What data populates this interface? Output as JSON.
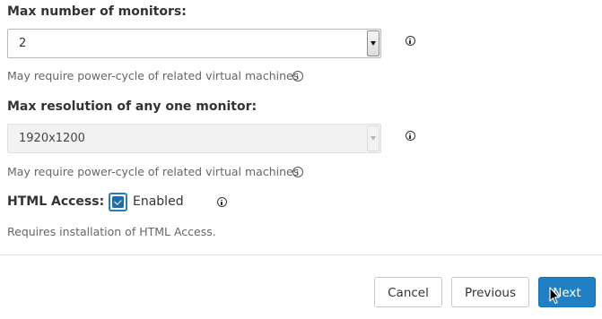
{
  "monitors": {
    "label": "Max number of monitors:",
    "value": "2",
    "hint": "May require power-cycle of related virtual machines"
  },
  "resolution": {
    "label": "Max resolution of any one monitor:",
    "value": "1920x1200",
    "disabled": true,
    "hint": "May require power-cycle of related virtual machines"
  },
  "html_access": {
    "label": "HTML Access:",
    "checkbox_label": "Enabled",
    "checked": true,
    "hint": "Requires installation of HTML Access."
  },
  "buttons": {
    "cancel": "Cancel",
    "previous": "Previous",
    "next": "Next"
  },
  "colors": {
    "primary": "#1f80c6",
    "checkbox": "#1a6fb0"
  },
  "icons": [
    "info-icon",
    "chevron-down-icon",
    "checkmark-icon",
    "mouse-cursor-icon"
  ]
}
